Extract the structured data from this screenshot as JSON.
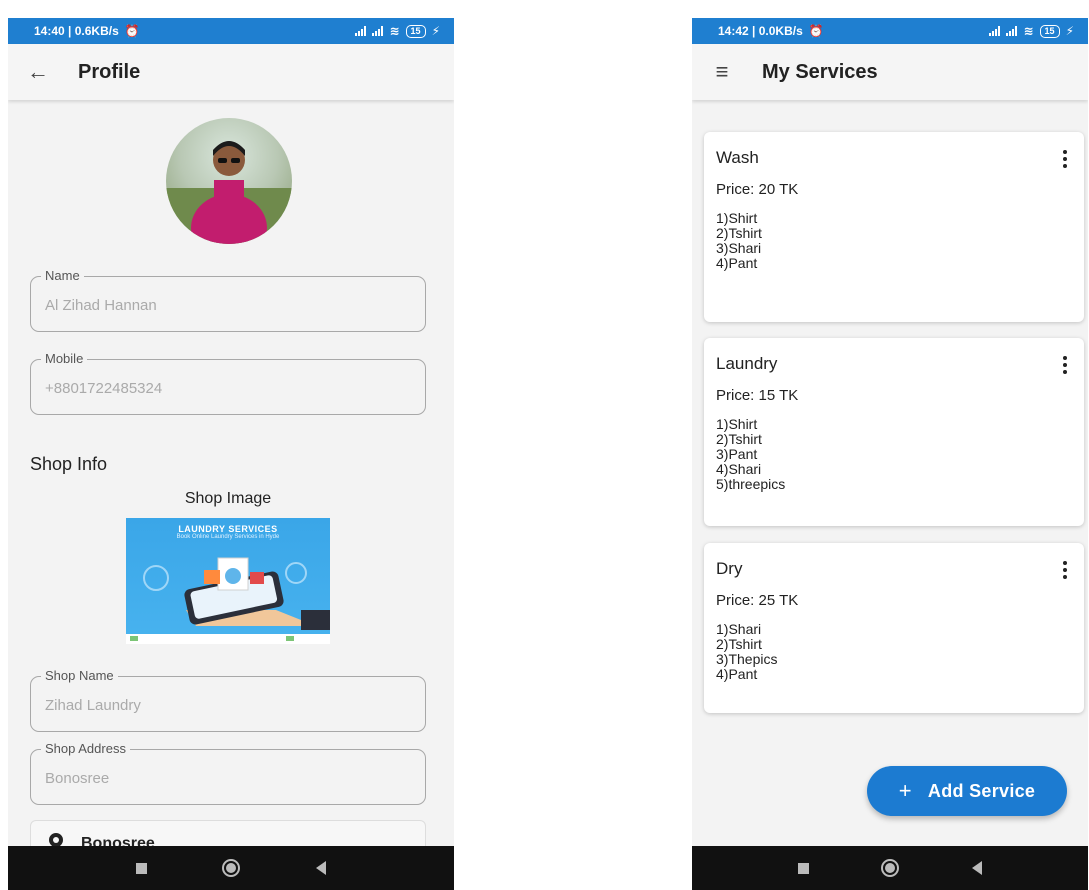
{
  "left": {
    "status": {
      "time": "14:40 | 0.6KB/s",
      "battery": "15"
    },
    "app_bar": {
      "title": "Profile"
    },
    "fields": {
      "name": {
        "label": "Name",
        "value": "Al Zihad Hannan"
      },
      "mobile": {
        "label": "Mobile",
        "value": "+8801722485324"
      },
      "shop_name": {
        "label": "Shop Name",
        "value": "Zihad Laundry"
      },
      "shop_address": {
        "label": "Shop Address",
        "value": "Bonosree"
      }
    },
    "shop_info_title": "Shop Info",
    "shop_image_label": "Shop Image",
    "shop_image_banner": "LAUNDRY SERVICES",
    "shop_image_subbanner": "Book Online Laundry Services in Hyde",
    "location_text": "Bonosree"
  },
  "right": {
    "status": {
      "time": "14:42 | 0.0KB/s",
      "battery": "15"
    },
    "app_bar": {
      "title": "My Services"
    },
    "services": [
      {
        "name": "Wash",
        "price": "Price:  20 TK",
        "items": [
          "1)Shirt",
          "2)Tshirt",
          "3)Shari",
          "4)Pant"
        ]
      },
      {
        "name": "Laundry",
        "price": "Price:  15 TK",
        "items": [
          "1)Shirt",
          "2)Tshirt",
          "3)Pant",
          "4)Shari",
          "5)threepics"
        ]
      },
      {
        "name": "Dry",
        "price": "Price:  25 TK",
        "items": [
          "1)Shari",
          "2)Tshirt",
          "3)Thepics",
          "4)Pant"
        ]
      }
    ],
    "fab_label": "Add Service",
    "fab_icon": "+"
  },
  "colors": {
    "primary": "#1c7bd1",
    "status_bar": "#1f7fd0",
    "background": "#f3f3f3"
  },
  "icons": {
    "back": "arrow-left-icon",
    "menu": "hamburger-icon",
    "more": "more-vert-icon",
    "location": "location-pin-icon"
  }
}
